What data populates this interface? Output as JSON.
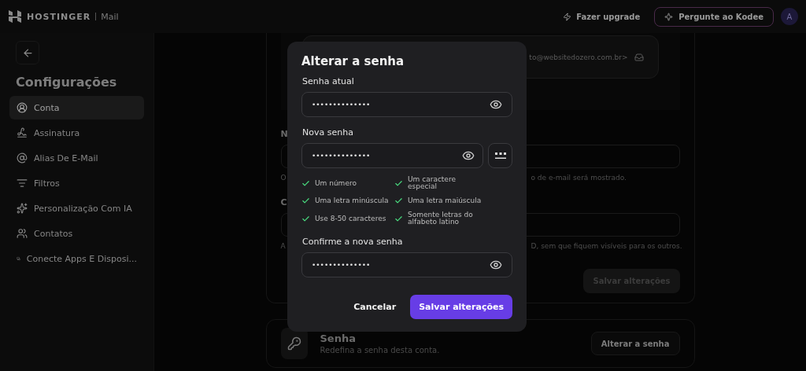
{
  "topbar": {
    "brand": "HOSTINGER",
    "product": "Mail",
    "upgrade": "Fazer upgrade",
    "assistant": "Pergunte ao Kodee",
    "avatar": "A"
  },
  "sidebar": {
    "title": "Configurações",
    "items": [
      {
        "label": "Conta",
        "selected": true
      },
      {
        "label": "Assinatura",
        "selected": false
      },
      {
        "label": "Alias De E-Mail",
        "selected": false
      },
      {
        "label": "Filtros",
        "selected": false
      },
      {
        "label": "Personalização Com IA",
        "selected": false
      },
      {
        "label": "Contatos",
        "selected": false
      },
      {
        "label": "Conecte Apps E Disposi...",
        "selected": false
      }
    ]
  },
  "account_card": {
    "email_fragment": "to@websitedozero.com.br>",
    "rows": [
      {
        "label_fragment": "N",
        "hint_left": "O",
        "hint_right": "o de e-mail será mostrado."
      },
      {
        "label_fragment": "C",
        "hint_left": "A",
        "hint_right": "D, sem que fiquem visíveis para os outros."
      }
    ],
    "save_button": {
      "label": "Salvar alterações",
      "disabled": true
    }
  },
  "password_card": {
    "title": "Senha",
    "description": "Redefina a senha desta conta.",
    "button": "Alterar a senha"
  },
  "dialog": {
    "title": "Alterar a senha",
    "current": {
      "label": "Senha atual",
      "value": "••••••••••••••"
    },
    "new": {
      "label": "Nova senha",
      "value": "••••••••••••••"
    },
    "requirements": [
      {
        "text": "Um número",
        "met": true
      },
      {
        "text": "Um caractere especial",
        "met": true
      },
      {
        "text": "Uma letra minúscula",
        "met": true
      },
      {
        "text": "Uma letra maiúscula",
        "met": true
      },
      {
        "text": "Use 8-50 caracteres",
        "met": true
      },
      {
        "text": "Somente letras do alfabeto latino",
        "met": true
      }
    ],
    "confirm": {
      "label": "Confirme a nova senha",
      "value": "••••••••••••••"
    },
    "cancel": "Cancelar",
    "save": "Salvar alterações"
  }
}
